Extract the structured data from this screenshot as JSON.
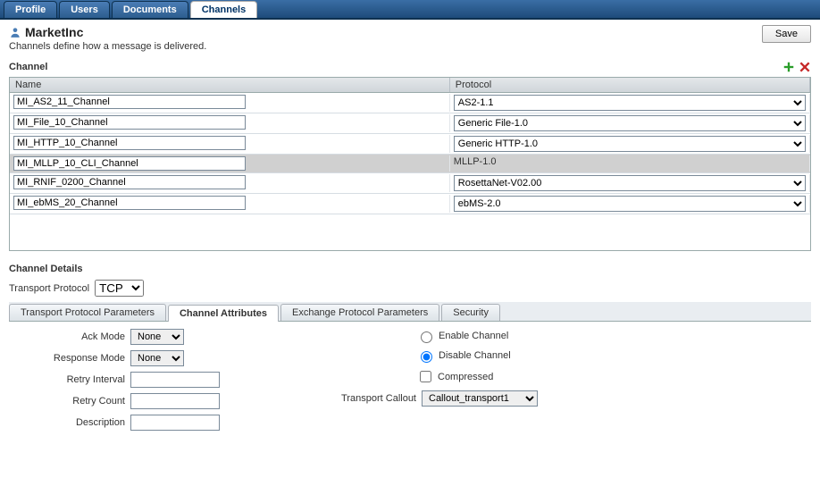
{
  "tabs": {
    "profile": "Profile",
    "users": "Users",
    "documents": "Documents",
    "channels": "Channels"
  },
  "header": {
    "title": "MarketInc",
    "subtitle": "Channels define how a message is delivered.",
    "save_label": "Save"
  },
  "channel_section": {
    "title": "Channel",
    "columns": {
      "name": "Name",
      "protocol": "Protocol"
    },
    "rows": [
      {
        "name": "MI_AS2_11_Channel",
        "protocol": "AS2-1.1",
        "selected": false,
        "has_dropdown": true
      },
      {
        "name": "MI_File_10_Channel",
        "protocol": "Generic File-1.0",
        "selected": false,
        "has_dropdown": true
      },
      {
        "name": "MI_HTTP_10_Channel",
        "protocol": "Generic HTTP-1.0",
        "selected": false,
        "has_dropdown": true
      },
      {
        "name": "MI_MLLP_10_CLI_Channel",
        "protocol": "MLLP-1.0",
        "selected": true,
        "has_dropdown": false
      },
      {
        "name": "MI_RNIF_0200_Channel",
        "protocol": "RosettaNet-V02.00",
        "selected": false,
        "has_dropdown": true
      },
      {
        "name": "MI_ebMS_20_Channel",
        "protocol": "ebMS-2.0",
        "selected": false,
        "has_dropdown": true
      }
    ]
  },
  "details": {
    "title": "Channel Details",
    "transport_protocol_label": "Transport Protocol",
    "transport_protocol_value": "TCP",
    "sub_tabs": {
      "tpp": "Transport Protocol Parameters",
      "ca": "Channel Attributes",
      "epp": "Exchange Protocol Parameters",
      "sec": "Security"
    },
    "form": {
      "ack_mode_label": "Ack Mode",
      "ack_mode_value": "None",
      "response_mode_label": "Response Mode",
      "response_mode_value": "None",
      "retry_interval_label": "Retry Interval",
      "retry_interval_value": "",
      "retry_count_label": "Retry Count",
      "retry_count_value": "",
      "description_label": "Description",
      "description_value": "",
      "enable_label": "Enable Channel",
      "disable_label": "Disable Channel",
      "compressed_label": "Compressed",
      "transport_callout_label": "Transport Callout",
      "transport_callout_value": "Callout_transport1"
    }
  }
}
